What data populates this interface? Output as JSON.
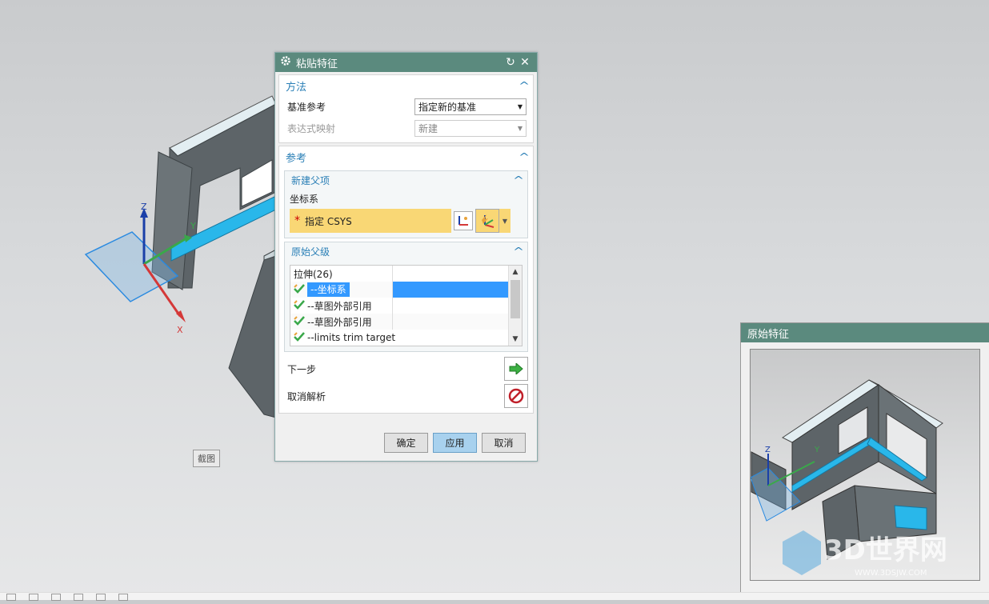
{
  "viewport": {
    "crop_label": "截图",
    "axes": {
      "z": "Z",
      "y": "Y",
      "x": "X"
    }
  },
  "dialog": {
    "title": "粘贴特征",
    "method": {
      "header": "方法",
      "base_ref_label": "基准参考",
      "base_ref_value": "指定新的基准",
      "expr_map_label": "表达式映射",
      "expr_map_value": "新建"
    },
    "reference": {
      "header": "参考",
      "new_parent": {
        "header": "新建父项",
        "csys_label": "坐标系",
        "csys_prompt": "指定 CSYS"
      },
      "original_parent": {
        "header": "原始父级",
        "rows": [
          {
            "name": "拉伸(26)",
            "checked": false,
            "selected": false
          },
          {
            "name": "--坐标系",
            "checked": true,
            "selected": true
          },
          {
            "name": "--草图外部引用",
            "checked": true,
            "selected": false
          },
          {
            "name": "--草图外部引用",
            "checked": true,
            "selected": false
          },
          {
            "name": "--limits trim target",
            "checked": true,
            "selected": false
          }
        ]
      }
    },
    "next_step_label": "下一步",
    "cancel_resolve_label": "取消解析",
    "buttons": {
      "ok": "确定",
      "apply": "应用",
      "cancel": "取消"
    },
    "colors": {
      "title_bar": "#5b8a7e",
      "accent": "#2a7fb6",
      "required_field": "#f9d775",
      "selection": "#3399ff"
    }
  },
  "preview": {
    "title": "原始特征",
    "watermark_text": "3D世界网",
    "watermark_url": "WWW.3DSJW.COM"
  }
}
